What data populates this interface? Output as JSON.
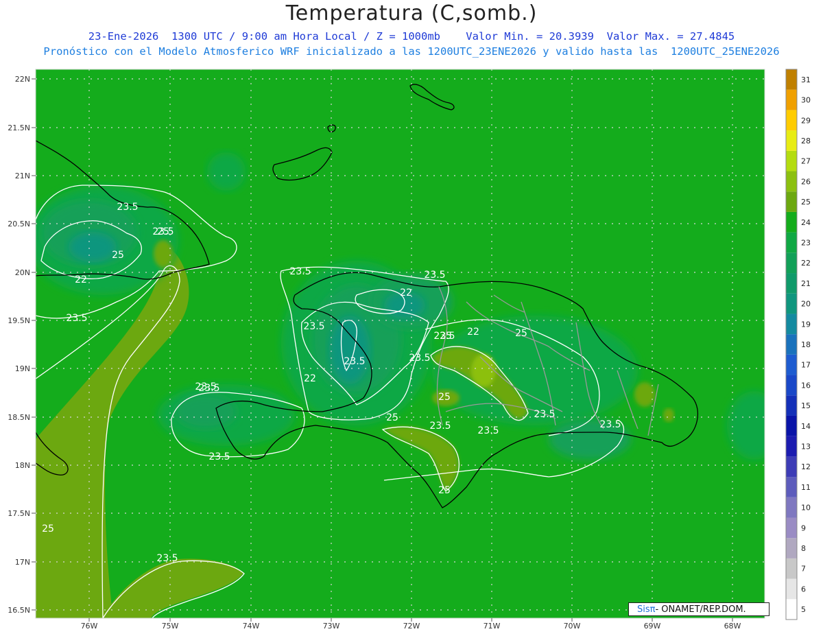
{
  "title": "Temperatura (C,somb.)",
  "subtitle_line1": "23-Ene-2026  1300 UTC / 9:00 am Hora Local / Z = 1000mb    Valor Min. = 20.3939  Valor Max. = 27.4845",
  "subtitle_line2": "Pronóstico con el Modelo Atmosferico WRF inicializado a las 1200UTC_23ENE2026 y valido hasta las  1200UTC_25ENE2026",
  "badge": {
    "brand": "Sisπ",
    "text": " - ONAMET/REP.DOM."
  },
  "chart_data": {
    "type": "heatmap",
    "lat_ticks": [
      "22N",
      "21.5N",
      "21N",
      "20.5N",
      "20N",
      "19.5N",
      "19N",
      "18.5N",
      "18N",
      "17.5N",
      "17N",
      "16.5N"
    ],
    "lon_ticks": [
      "76W",
      "75W",
      "74W",
      "73W",
      "72W",
      "71W",
      "70W",
      "69W",
      "68W"
    ],
    "colorbar": [
      {
        "value": 5,
        "color": "#ffffff"
      },
      {
        "value": 6,
        "color": "#e6e6e6"
      },
      {
        "value": 7,
        "color": "#c8c8c8"
      },
      {
        "value": 8,
        "color": "#b0a8c0"
      },
      {
        "value": 9,
        "color": "#9a8cc4"
      },
      {
        "value": 10,
        "color": "#7f78c0"
      },
      {
        "value": 11,
        "color": "#5d5cbc"
      },
      {
        "value": 12,
        "color": "#3d3cb6"
      },
      {
        "value": 13,
        "color": "#1c1cb0"
      },
      {
        "value": 14,
        "color": "#0a14a8"
      },
      {
        "value": 15,
        "color": "#1430b8"
      },
      {
        "value": 16,
        "color": "#1a48c8"
      },
      {
        "value": 17,
        "color": "#1e5cd0"
      },
      {
        "value": 18,
        "color": "#1a72bc"
      },
      {
        "value": 19,
        "color": "#148aa0"
      },
      {
        "value": 20,
        "color": "#10967e"
      },
      {
        "value": 21,
        "color": "#109a6a"
      },
      {
        "value": 22,
        "color": "#12a058"
      },
      {
        "value": 23,
        "color": "#10a844"
      },
      {
        "value": 24,
        "color": "#14ac1c"
      },
      {
        "value": 25,
        "color": "#6ca810"
      },
      {
        "value": 26,
        "color": "#8cc010"
      },
      {
        "value": 27,
        "color": "#b4dc10"
      },
      {
        "value": 28,
        "color": "#e8ec14"
      },
      {
        "value": 29,
        "color": "#ffcc00"
      },
      {
        "value": 30,
        "color": "#f0a000"
      },
      {
        "value": 31,
        "color": "#c08000"
      }
    ],
    "contour_labels": [
      "23.5",
      "23.5",
      "25",
      "22",
      "23.5",
      "23.5",
      "23.5",
      "22",
      "23.5",
      "22",
      "25",
      "23.5",
      "23.5",
      "23.5",
      "22",
      "23.5",
      "23.5",
      "23.5",
      "25",
      "25",
      "23.5",
      "23.5",
      "23.5",
      "23.5",
      "25",
      "25",
      "23.5",
      "25",
      "25"
    ],
    "min_value": 20.3939,
    "max_value": 27.4845
  }
}
